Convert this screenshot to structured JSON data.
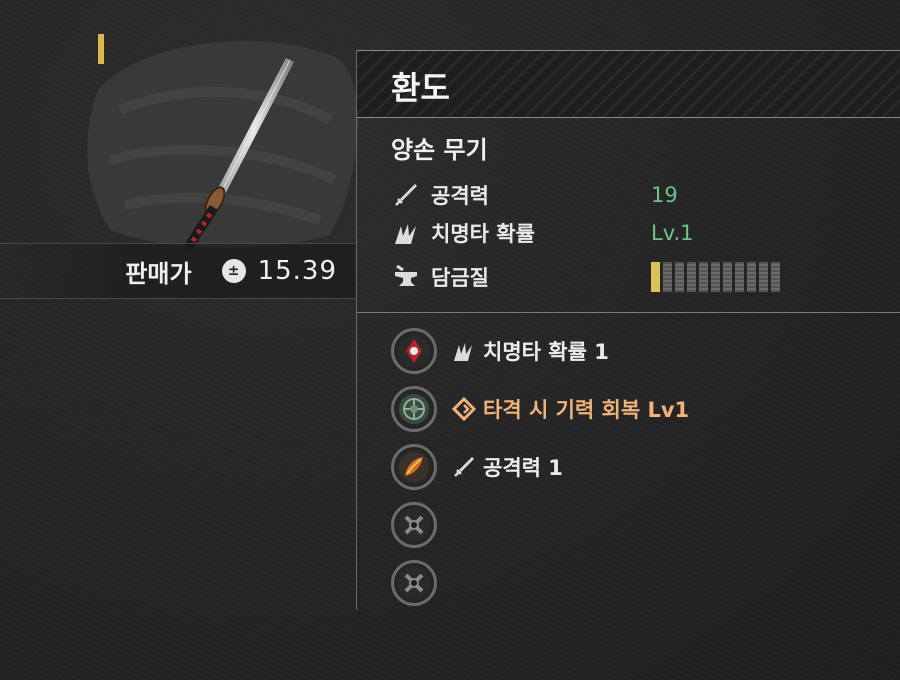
{
  "item": {
    "name": "환도",
    "type": "양손 무기",
    "icon": "katana-icon",
    "rarity_color": "#d9b84e"
  },
  "price": {
    "label": "판매가",
    "currency_icon": "coin-icon",
    "currency_symbol": "±",
    "value": "15.39"
  },
  "stats": [
    {
      "icon": "sword-icon",
      "label": "공격력",
      "value": "19"
    },
    {
      "icon": "critical-slash-icon",
      "label": "치명타 확률",
      "value": "Lv.1"
    },
    {
      "icon": "anvil-icon",
      "label": "담금질",
      "durability": {
        "filled": 1,
        "total": 11
      }
    }
  ],
  "traits": [
    {
      "socket": "red-gem-socket",
      "icon": "critical-slash-icon",
      "text": "치명타 확률 1",
      "color": "#ececec"
    },
    {
      "socket": "green-gem-socket",
      "icon": "diamond-spiral-icon",
      "text": "타격 시 기력 회복 Lv1",
      "color": "#f0b47a"
    },
    {
      "socket": "orange-gem-socket",
      "icon": "sword-icon",
      "text": "공격력 1",
      "color": "#ececec"
    },
    {
      "socket": "empty-socket",
      "icon": "",
      "text": ""
    },
    {
      "socket": "empty-socket",
      "icon": "",
      "text": ""
    }
  ],
  "colors": {
    "stat_value": "#6cc38a",
    "special_trait": "#f0b47a",
    "durability_filled": "#d9c25a"
  }
}
